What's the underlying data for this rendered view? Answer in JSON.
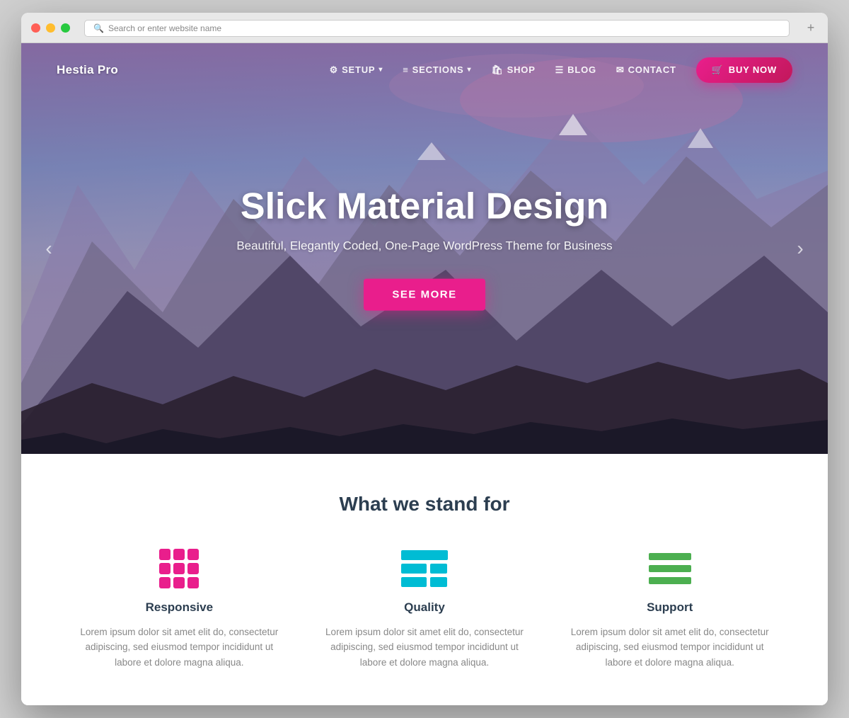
{
  "browser": {
    "url_placeholder": "Search or enter website name"
  },
  "navbar": {
    "brand": "Hestia Pro",
    "items": [
      {
        "id": "setup",
        "label": "SETUP",
        "icon": "⚙",
        "has_dropdown": true
      },
      {
        "id": "sections",
        "label": "SECTIONS",
        "icon": "≡",
        "has_dropdown": true
      },
      {
        "id": "shop",
        "label": "SHOP",
        "icon": "🛍"
      },
      {
        "id": "blog",
        "label": "BLOG",
        "icon": "☰"
      },
      {
        "id": "contact",
        "label": "CONTACT",
        "icon": "✉"
      }
    ],
    "cta": {
      "label": "BUY NOW",
      "icon": "🛒"
    }
  },
  "hero": {
    "title": "Slick Material Design",
    "subtitle": "Beautiful, Elegantly Coded, One-Page WordPress Theme for Business",
    "cta_label": "SEE MORE"
  },
  "features": {
    "section_title": "What we stand for",
    "items": [
      {
        "id": "responsive",
        "name": "Responsive",
        "description": "Lorem ipsum dolor sit amet elit do, consectetur adipiscing, sed eiusmod tempor incididunt ut labore et dolore magna aliqua."
      },
      {
        "id": "quality",
        "name": "Quality",
        "description": "Lorem ipsum dolor sit amet elit do, consectetur adipiscing, sed eiusmod tempor incididunt ut labore et dolore magna aliqua."
      },
      {
        "id": "support",
        "name": "Support",
        "description": "Lorem ipsum dolor sit amet elit do, consectetur adipiscing, sed eiusmod tempor incididunt ut labore et dolore magna aliqua."
      }
    ]
  }
}
